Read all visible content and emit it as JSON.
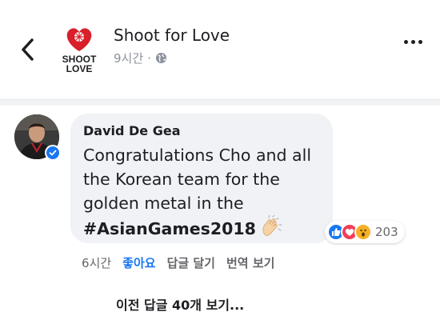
{
  "header": {
    "page_name": "Shoot for Love",
    "time": "9시간",
    "separator": "·"
  },
  "logo": {
    "line1": "SHOOT",
    "line2": "LOVE",
    "brand_color": "#d81f2a"
  },
  "comment": {
    "author": "David De Gea",
    "text": "Congratulations Cho and all the Korean team for the golden metal in the",
    "hashtag": "#AsianGames2018",
    "emoji": "clapping-hands",
    "reactions": {
      "types": [
        "like",
        "love",
        "wow"
      ],
      "count": "203"
    }
  },
  "actions": {
    "time": "6시간",
    "like": "좋아요",
    "reply": "답글 달기",
    "translate": "번역 보기"
  },
  "prev_replies": "이전 답글 40개 보기...",
  "colors": {
    "accent": "#1877f2",
    "bubble": "#f0f2f5",
    "muted": "#65676b"
  }
}
